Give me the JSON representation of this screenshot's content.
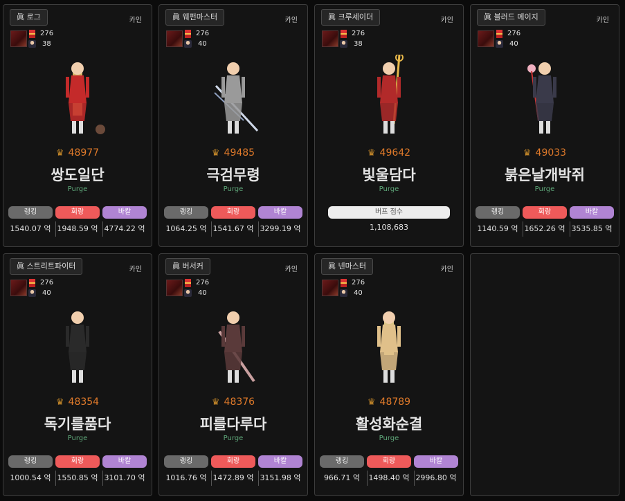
{
  "server_label": "카인",
  "buff_label": "버프 점수",
  "stat_labels": [
    "랭킹",
    "회랑",
    "바칼"
  ],
  "cards": [
    {
      "job": "眞 로그",
      "fame_level": "276",
      "char_level": "38",
      "fame": "48977",
      "name": "쌍도일단",
      "guild": "Purge",
      "stats": [
        "1540.07 억",
        "1948.59 억",
        "4774.22 억"
      ],
      "sprite": "rogue",
      "color": "#c42a2a"
    },
    {
      "job": "眞 웨펀마스터",
      "fame_level": "276",
      "char_level": "40",
      "fame": "49485",
      "name": "극검무령",
      "guild": "Purge",
      "stats": [
        "1064.25 억",
        "1541.67 억",
        "3299.19 억"
      ],
      "sprite": "weapon-master",
      "color": "#9a9a9a"
    },
    {
      "job": "眞 크루세이더",
      "fame_level": "276",
      "char_level": "38",
      "fame": "49642",
      "name": "빛울담다",
      "guild": "Purge",
      "buff": "1,108,683",
      "sprite": "crusader",
      "color": "#b22a2a"
    },
    {
      "job": "眞 블러드 메이지",
      "fame_level": "276",
      "char_level": "40",
      "fame": "49033",
      "name": "붉은날개박쥐",
      "guild": "Purge",
      "stats": [
        "1140.59 억",
        "1652.26 억",
        "3535.85 억"
      ],
      "sprite": "blood-mage",
      "color": "#3a3a4a"
    },
    {
      "job": "眞 스트리트파이터",
      "fame_level": "276",
      "char_level": "40",
      "fame": "48354",
      "name": "독기를품다",
      "guild": "Purge",
      "stats": [
        "1000.54 억",
        "1550.85 억",
        "3101.70 억"
      ],
      "sprite": "street-fighter",
      "color": "#2a2a2a"
    },
    {
      "job": "眞 버서커",
      "fame_level": "276",
      "char_level": "40",
      "fame": "48376",
      "name": "피를다루다",
      "guild": "Purge",
      "stats": [
        "1016.76 억",
        "1472.89 억",
        "3151.98 억"
      ],
      "sprite": "berserker",
      "color": "#5a3a3a"
    },
    {
      "job": "眞 넨마스터",
      "fame_level": "276",
      "char_level": "40",
      "fame": "48789",
      "name": "활성화순결",
      "guild": "Purge",
      "stats": [
        "966.71 억",
        "1498.40 억",
        "2996.80 억"
      ],
      "sprite": "nen-master",
      "color": "#e0c08a"
    }
  ]
}
